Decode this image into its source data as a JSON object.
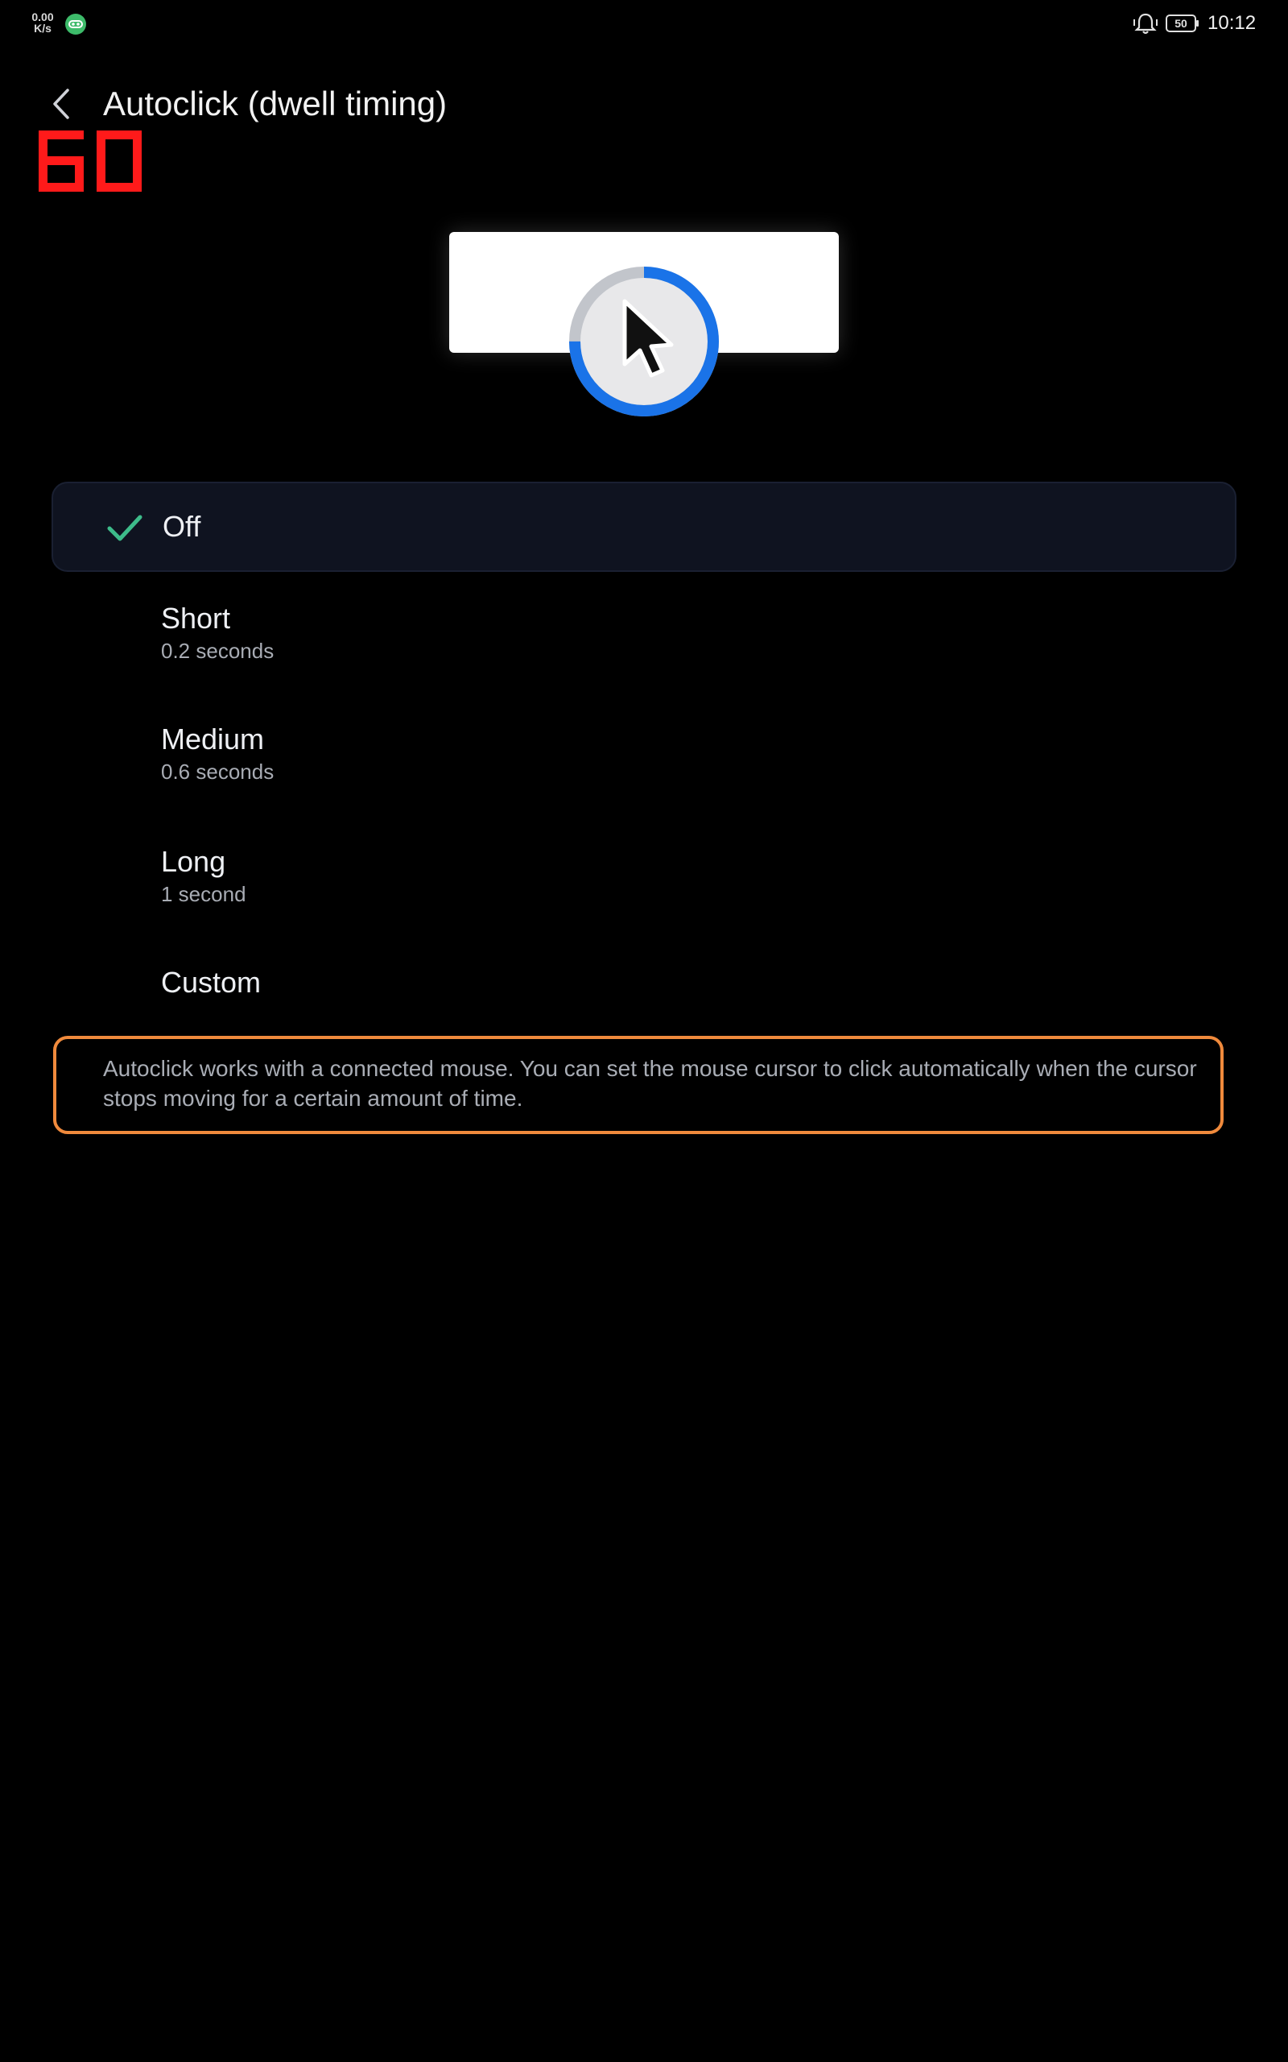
{
  "status_bar": {
    "net_speed_value": "0.00",
    "net_speed_unit": "K/s",
    "battery_level": "50",
    "time": "10:12"
  },
  "header": {
    "title": "Autoclick (dwell timing)",
    "fps_counter": "60"
  },
  "illustration": {
    "dwell_progress": 0.75,
    "ring_color": "#1a73e8",
    "ring_track_color": "#c2c5cb"
  },
  "options": [
    {
      "label": "Off",
      "sub": "",
      "selected": true
    },
    {
      "label": "Short",
      "sub": "0.2 seconds",
      "selected": false
    },
    {
      "label": "Medium",
      "sub": "0.6 seconds",
      "selected": false
    },
    {
      "label": "Long",
      "sub": "1 second",
      "selected": false
    },
    {
      "label": "Custom",
      "sub": "",
      "selected": false
    }
  ],
  "info": {
    "text": "Autoclick works with a connected mouse. You can set the mouse cursor to click automatically when the cursor stops moving for a certain amount of time."
  },
  "colors": {
    "background": "#000000",
    "selected_row": "#0f1320",
    "check": "#3dbb8a",
    "info_border": "#f08a3c",
    "fps_counter": "#ff1a1a"
  }
}
